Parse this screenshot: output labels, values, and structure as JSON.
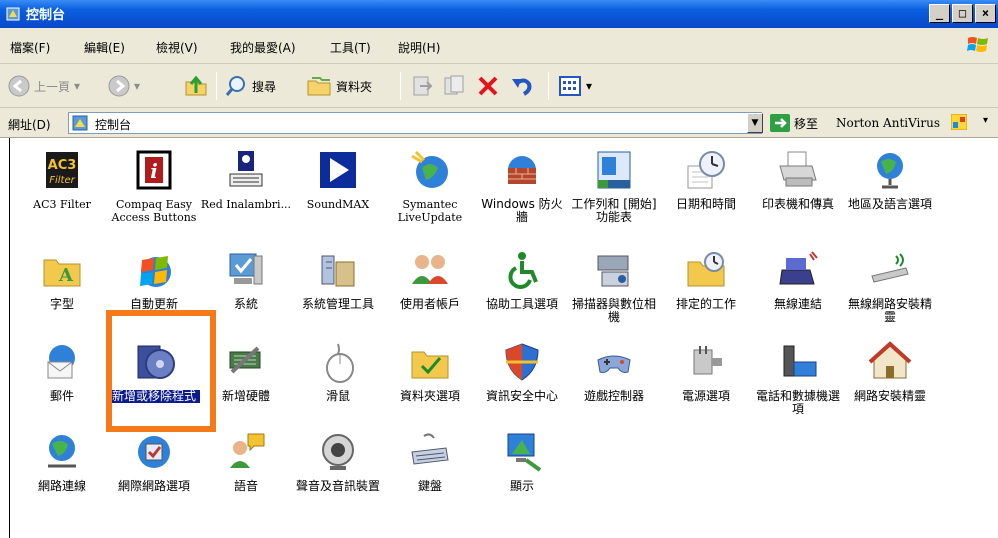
{
  "window": {
    "title": "控制台"
  },
  "menu": [
    "檔案(F)",
    "編輯(E)",
    "檢視(V)",
    "我的最愛(A)",
    "工具(T)",
    "說明(H)"
  ],
  "toolbar": {
    "back_label": "上一頁",
    "search_label": "搜尋",
    "folders_label": "資料夾"
  },
  "address": {
    "label": "網址(D)",
    "value": "控制台",
    "go_label": "移至",
    "norton_label": "Norton AntiVirus"
  },
  "items": [
    {
      "label": "AC3 Filter",
      "icon": "ac3-filter-icon"
    },
    {
      "label": "Compaq Easy Access Buttons",
      "icon": "info-icon"
    },
    {
      "label": "Red Inalambri...",
      "icon": "keyboard-mouse-icon"
    },
    {
      "label": "SoundMAX",
      "icon": "play-icon"
    },
    {
      "label": "Symantec LiveUpdate",
      "icon": "globe-update-icon"
    },
    {
      "label": "Windows 防火牆",
      "icon": "firewall-icon"
    },
    {
      "label": "工作列和 [開始] 功能表",
      "icon": "taskbar-icon"
    },
    {
      "label": "日期和時間",
      "icon": "clock-icon"
    },
    {
      "label": "印表機和傳真",
      "icon": "printer-icon"
    },
    {
      "label": "地區及語言選項",
      "icon": "globe-icon"
    },
    {
      "label": "字型",
      "icon": "font-folder-icon"
    },
    {
      "label": "自動更新",
      "icon": "windows-update-icon"
    },
    {
      "label": "系統",
      "icon": "system-icon"
    },
    {
      "label": "系統管理工具",
      "icon": "admin-tools-icon"
    },
    {
      "label": "使用者帳戶",
      "icon": "users-icon"
    },
    {
      "label": "協助工具選項",
      "icon": "accessibility-icon"
    },
    {
      "label": "掃描器與數位相機",
      "icon": "scanner-icon"
    },
    {
      "label": "排定的工作",
      "icon": "scheduled-tasks-icon"
    },
    {
      "label": "無線連結",
      "icon": "wireless-link-icon"
    },
    {
      "label": "無線網路安裝精靈",
      "icon": "wireless-wizard-icon"
    },
    {
      "label": "郵件",
      "icon": "mail-icon"
    },
    {
      "label": "新增或移除程式",
      "icon": "add-remove-programs-icon"
    },
    {
      "label": "新增硬體",
      "icon": "add-hardware-icon"
    },
    {
      "label": "滑鼠",
      "icon": "mouse-icon"
    },
    {
      "label": "資料夾選項",
      "icon": "folder-options-icon"
    },
    {
      "label": "資訊安全中心",
      "icon": "security-center-icon"
    },
    {
      "label": "遊戲控制器",
      "icon": "game-controller-icon"
    },
    {
      "label": "電源選項",
      "icon": "power-icon"
    },
    {
      "label": "電話和數據機選項",
      "icon": "phone-modem-icon"
    },
    {
      "label": "網路安裝精靈",
      "icon": "network-setup-icon"
    },
    {
      "label": "網路連線",
      "icon": "network-connections-icon"
    },
    {
      "label": "網際網路選項",
      "icon": "internet-options-icon"
    },
    {
      "label": "語音",
      "icon": "speech-icon"
    },
    {
      "label": "聲音及音訊裝置",
      "icon": "sound-icon"
    },
    {
      "label": "鍵盤",
      "icon": "keyboard-icon"
    },
    {
      "label": "顯示",
      "icon": "display-icon"
    }
  ],
  "selected_item": "新增或移除程式",
  "colors": {
    "title_bar": "#0a5fe0",
    "selection": "#0b1a8c",
    "highlight_box": "#f47a1a"
  }
}
